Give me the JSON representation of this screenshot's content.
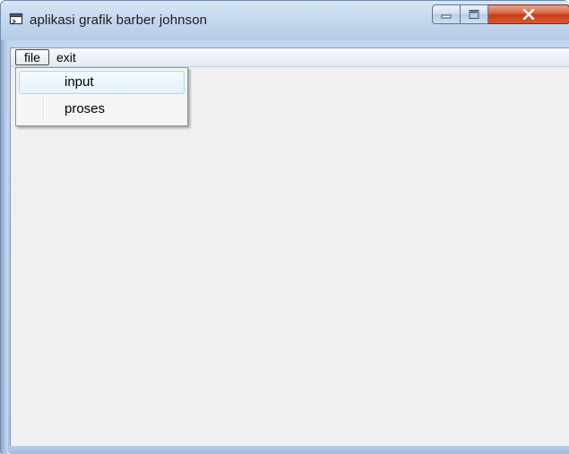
{
  "window": {
    "title": "aplikasi grafik barber johnson",
    "icon": "app-window-icon"
  },
  "caption_buttons": {
    "minimize_icon": "minimize-icon",
    "maximize_icon": "maximize-icon",
    "close_icon": "close-icon",
    "close_color": "#c73d16"
  },
  "menubar": {
    "items": [
      {
        "label": "file",
        "state": "open"
      },
      {
        "label": "exit"
      }
    ]
  },
  "file_menu": {
    "items": [
      {
        "label": "input",
        "state": "highlighted"
      },
      {
        "label": "proses"
      }
    ]
  },
  "colors": {
    "client_background": "#f0f0f0",
    "highlight_border": "#a8d8f0",
    "frame": "#b7cfea"
  }
}
